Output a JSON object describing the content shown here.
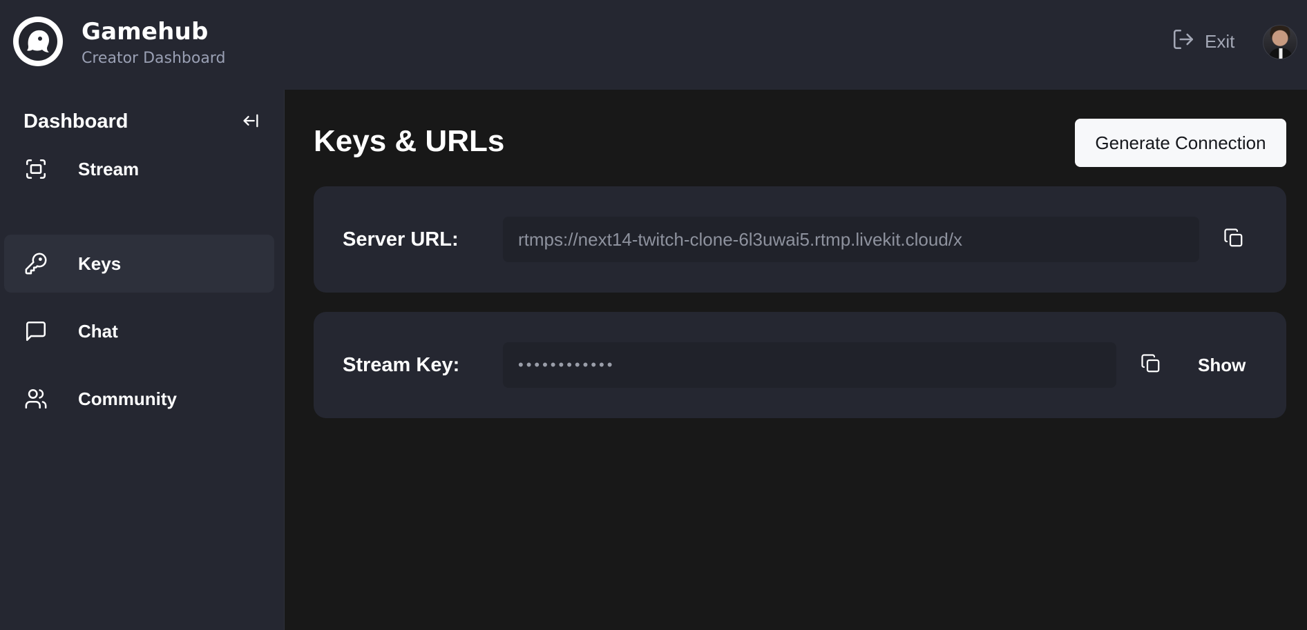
{
  "header": {
    "brand_title": "Gamehub",
    "brand_subtitle": "Creator Dashboard",
    "exit_label": "Exit",
    "logo_icon": "ghost-logo-icon",
    "exit_icon": "log-out-icon"
  },
  "sidebar": {
    "title": "Dashboard",
    "collapse_icon": "arrow-left-to-line-icon",
    "items": [
      {
        "label": "Stream",
        "icon": "fullscreen-icon",
        "active": false
      },
      {
        "label": "Keys",
        "icon": "key-icon",
        "active": true
      },
      {
        "label": "Chat",
        "icon": "message-square-icon",
        "active": false
      },
      {
        "label": "Community",
        "icon": "users-icon",
        "active": false
      }
    ]
  },
  "main": {
    "title": "Keys & URLs",
    "generate_button": "Generate Connection",
    "server_url": {
      "label": "Server URL:",
      "value": "rtmps://next14-twitch-clone-6l3uwai5.rtmp.livekit.cloud/x",
      "copy_icon": "copy-icon"
    },
    "stream_key": {
      "label": "Stream Key:",
      "masked_value": "••••••••••••",
      "copy_icon": "copy-icon",
      "show_label": "Show"
    }
  },
  "colors": {
    "background": "#181818",
    "panel": "#252731",
    "field": "#20222a",
    "active_item": "#2d303b",
    "muted_text": "#9aa0b4"
  }
}
